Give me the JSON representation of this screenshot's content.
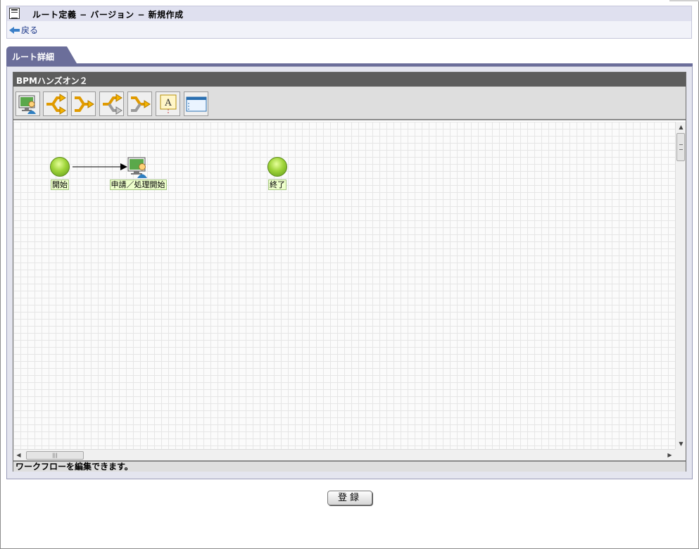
{
  "window": {
    "title": "ルート定義 − バージョン − 新規作成",
    "back_label": "戻る"
  },
  "tabs": [
    {
      "label": "ルート詳細",
      "active": true
    }
  ],
  "editor": {
    "header": "BPMハンズオン２",
    "toolbar": [
      {
        "icon": "user-task-icon"
      },
      {
        "icon": "branch-split-icon"
      },
      {
        "icon": "branch-join-icon"
      },
      {
        "icon": "branch-split-gray-icon"
      },
      {
        "icon": "branch-join-gray-icon"
      },
      {
        "icon": "text-annotation-icon"
      },
      {
        "icon": "window-frame-icon"
      }
    ],
    "nodes": {
      "start": "開始",
      "apply": "申請／処理開始",
      "end": "終了"
    },
    "status": "ワークフローを編集できます。"
  },
  "actions": {
    "register": "登録"
  },
  "colors": {
    "tab": "#6b6e9a",
    "node_green": "#9fd43a",
    "label_bg": "#eeffcc"
  }
}
